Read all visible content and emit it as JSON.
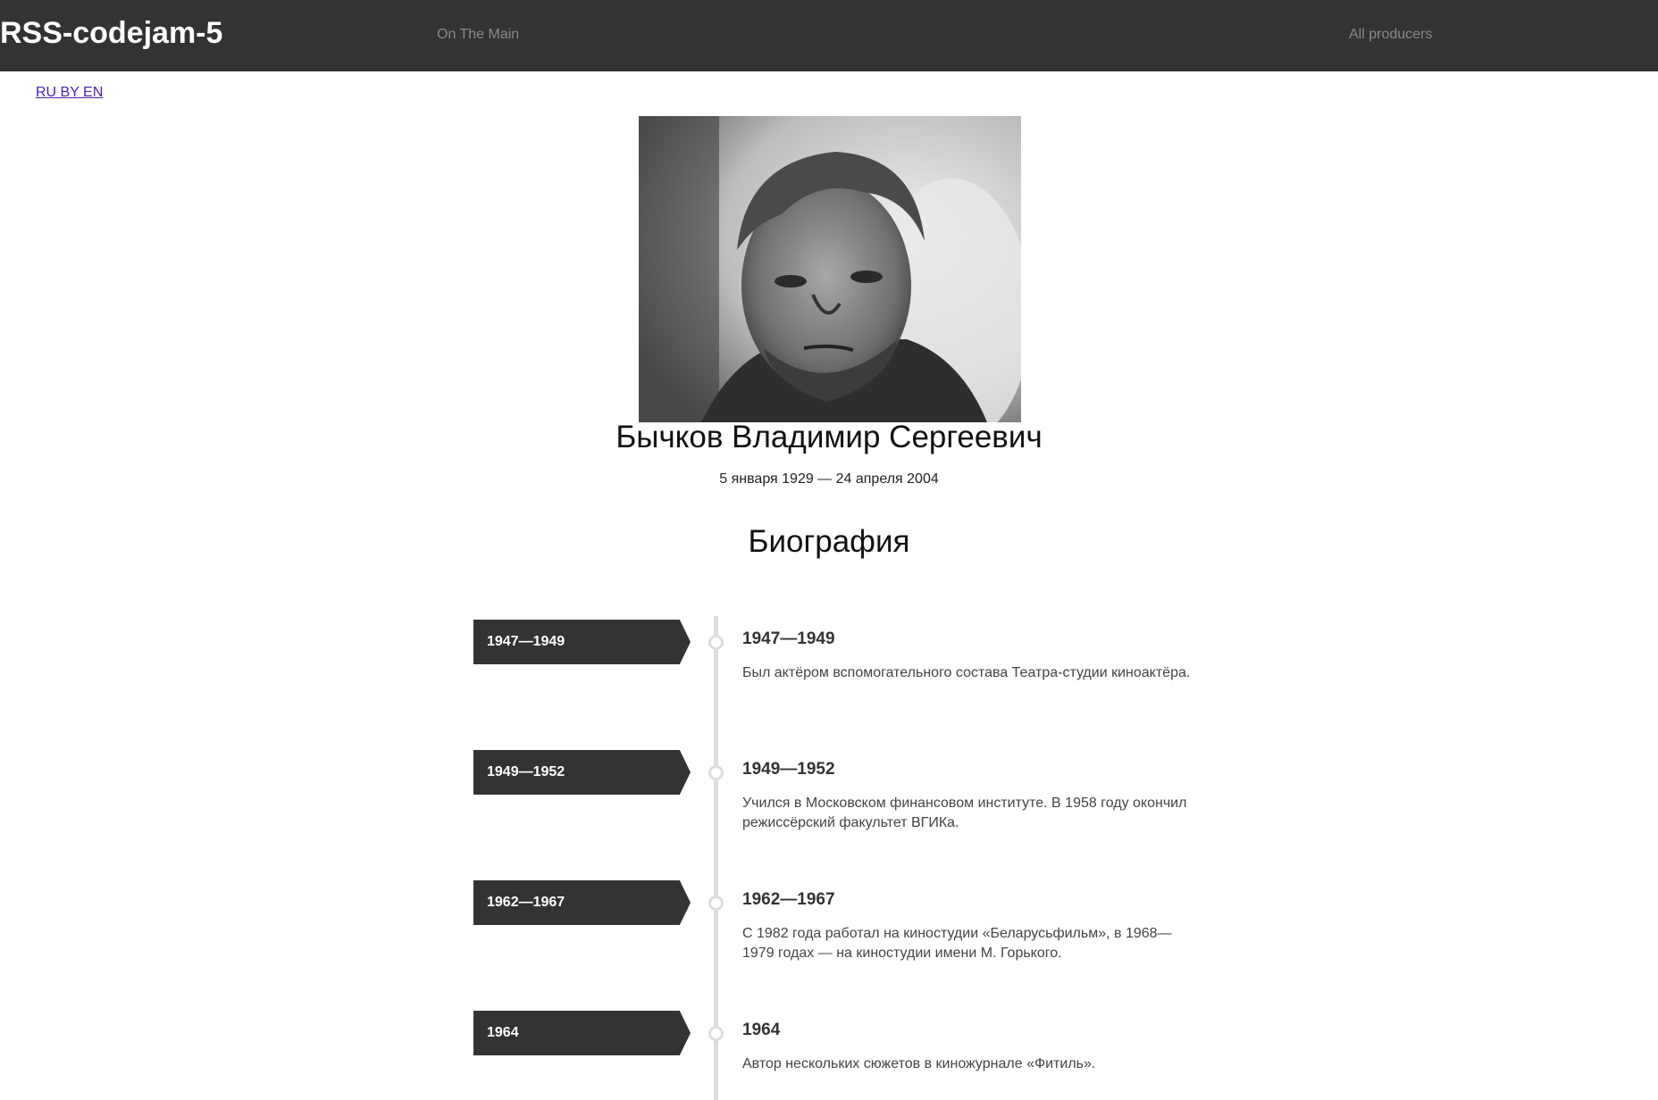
{
  "header": {
    "brand": "RSS-codejam-5",
    "nav": {
      "main": "On The Main",
      "producers": "All producers"
    }
  },
  "language_switch": "RU BY EN",
  "person": {
    "name": "Бычков Владимир Сергеевич",
    "dates": "5 января 1929 — 24 апреля 2004",
    "photo_alt": "portrait-photo"
  },
  "biography": {
    "heading": "Биография",
    "items": [
      {
        "tag": "1947—1949",
        "title": "1947—1949",
        "text": "Был актёром вспомогательного состава Театра-студии киноактёра."
      },
      {
        "tag": "1949—1952",
        "title": "1949—1952",
        "text": "Учился в Московском финансовом институте. В 1958 году окончил режиссёрский факультет ВГИКа."
      },
      {
        "tag": "1962—1967",
        "title": "1962—1967",
        "text": "С 1982 года работал на киностудии «Беларусьфильм», в 1968—1979 годах — на киностудии имени М. Горького."
      },
      {
        "tag": "1964",
        "title": "1964",
        "text": "Автор нескольких сюжетов в киножурнале «Фитиль»."
      }
    ]
  },
  "colors": {
    "header_bg": "#333333",
    "tag_bg": "#333333",
    "timeline_line": "#dddddd",
    "link": "#4a1fb8"
  }
}
